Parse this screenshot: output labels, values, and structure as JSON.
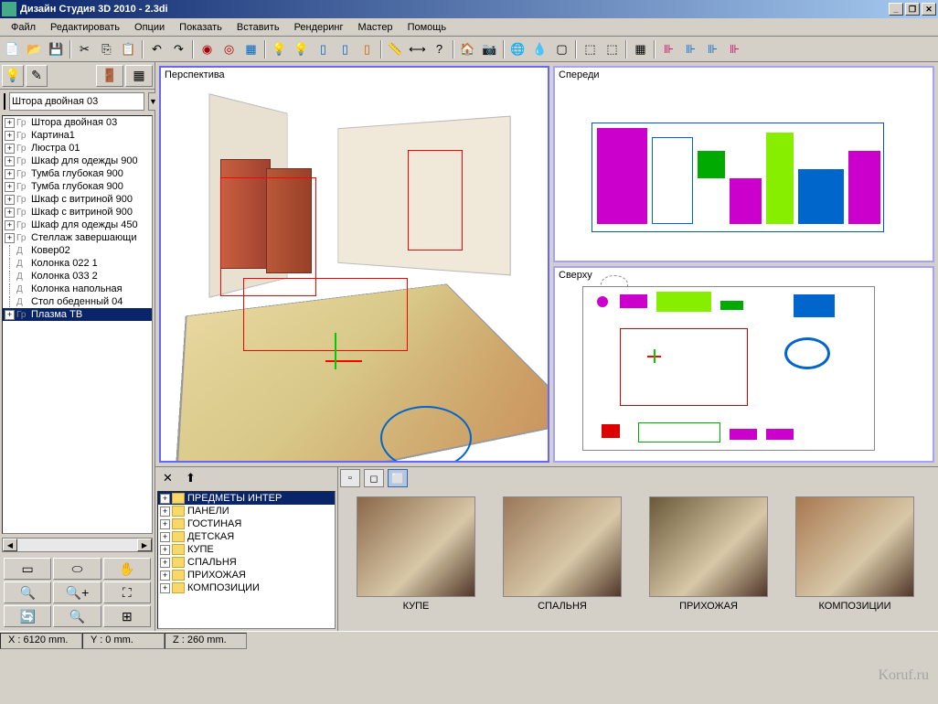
{
  "title": "Дизайн Студия 3D 2010 - 2.3di",
  "menu": [
    "Файл",
    "Редактировать",
    "Опции",
    "Показать",
    "Вставить",
    "Рендеринг",
    "Мастер",
    "Помощь"
  ],
  "selector": {
    "value": "Штора двойная 03"
  },
  "tree": [
    {
      "exp": "+",
      "icon": "Гр",
      "label": "Штора двойная 03"
    },
    {
      "exp": "+",
      "icon": "Гр",
      "label": "Картина1"
    },
    {
      "exp": "+",
      "icon": "Гр",
      "label": "Люстра 01"
    },
    {
      "exp": "+",
      "icon": "Гр",
      "label": "Шкаф для одежды 900"
    },
    {
      "exp": "+",
      "icon": "Гр",
      "label": "Тумба глубокая 900"
    },
    {
      "exp": "+",
      "icon": "Гр",
      "label": "Тумба глубокая 900"
    },
    {
      "exp": "+",
      "icon": "Гр",
      "label": "Шкаф с витриной 900"
    },
    {
      "exp": "+",
      "icon": "Гр",
      "label": "Шкаф с витриной 900"
    },
    {
      "exp": "+",
      "icon": "Гр",
      "label": "Шкаф для одежды 450"
    },
    {
      "exp": "+",
      "icon": "Гр",
      "label": "Стеллаж завершающи"
    },
    {
      "exp": "",
      "icon": "Д",
      "label": "Ковер02"
    },
    {
      "exp": "",
      "icon": "Д",
      "label": "Колонка 022 1"
    },
    {
      "exp": "",
      "icon": "Д",
      "label": "Колонка 033 2"
    },
    {
      "exp": "",
      "icon": "Д",
      "label": "Колонка напольная"
    },
    {
      "exp": "",
      "icon": "Д",
      "label": "Стол обеденный 04"
    },
    {
      "exp": "+",
      "icon": "Гр",
      "label": "Плазма ТВ",
      "selected": true
    }
  ],
  "viewports": {
    "perspective": "Перспектива",
    "front": "Спереди",
    "top": "Сверху"
  },
  "categories": [
    {
      "label": "ПРЕДМЕТЫ ИНТЕР",
      "selected": true
    },
    {
      "label": "ПАНЕЛИ"
    },
    {
      "label": "ГОСТИНАЯ"
    },
    {
      "label": "ДЕТСКАЯ"
    },
    {
      "label": "КУПЕ"
    },
    {
      "label": "СПАЛЬНЯ"
    },
    {
      "label": "ПРИХОЖАЯ"
    },
    {
      "label": "КОМПОЗИЦИИ"
    }
  ],
  "thumbs": [
    {
      "label": "КУПЕ"
    },
    {
      "label": "СПАЛЬНЯ"
    },
    {
      "label": "ПРИХОЖАЯ"
    },
    {
      "label": "КОМПОЗИЦИИ"
    }
  ],
  "status": {
    "x": "X : 6120 mm.",
    "y": "Y : 0 mm.",
    "z": "Z : 260 mm."
  },
  "watermark": "Koruf.ru"
}
